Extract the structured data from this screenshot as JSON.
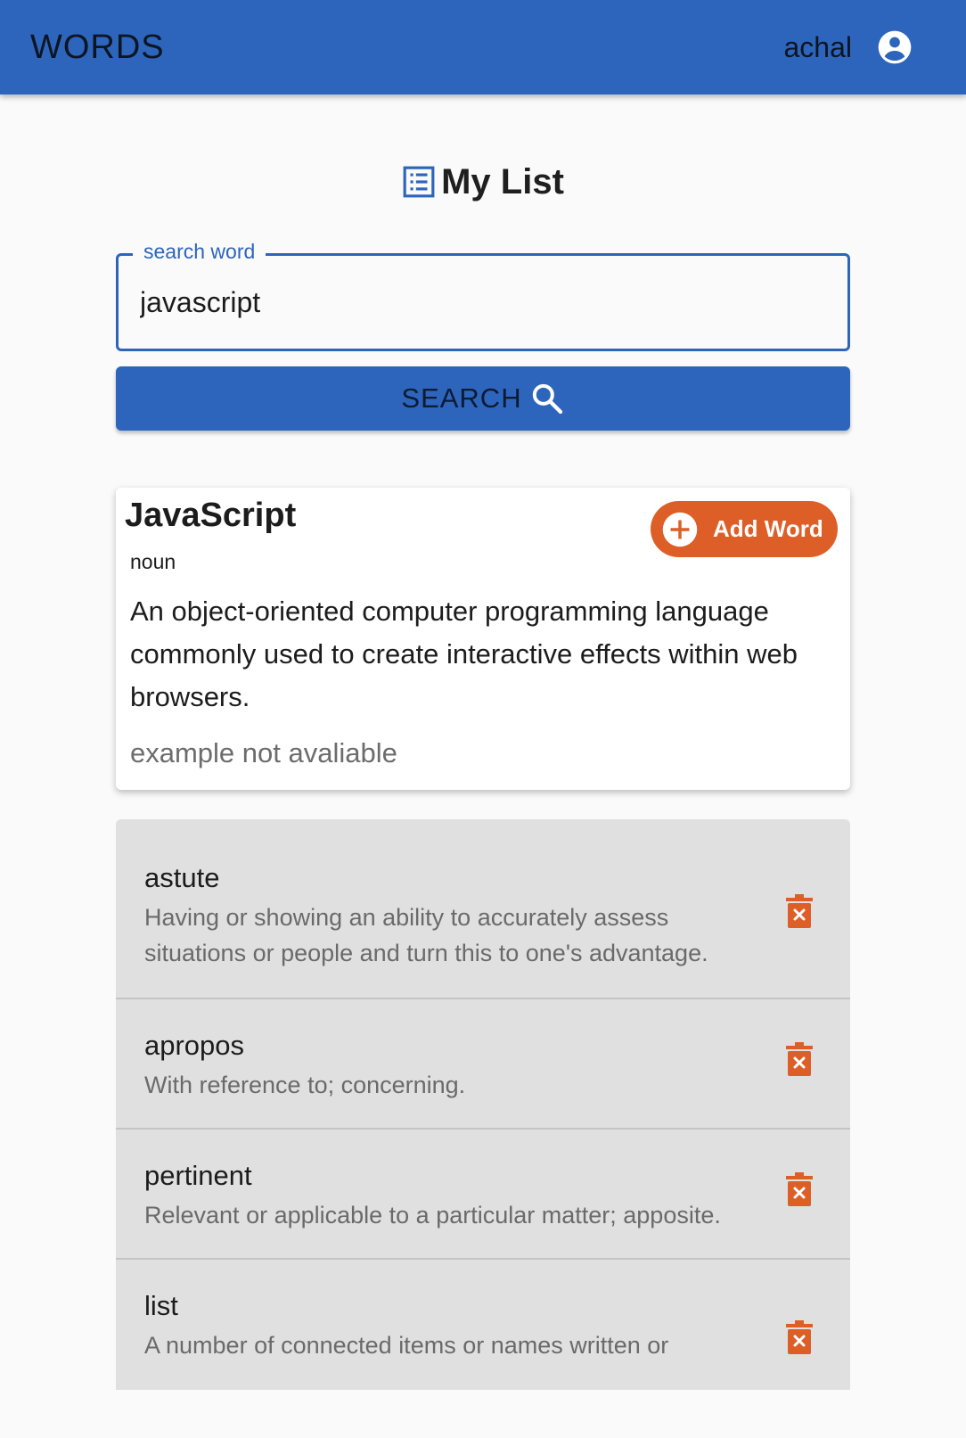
{
  "appbar": {
    "brand": "WORDS",
    "username": "achal",
    "avatar_icon": "account-circle-icon"
  },
  "heading": {
    "icon": "list-icon",
    "title": "My List"
  },
  "search": {
    "label": "search word",
    "value": "javascript",
    "button_label": "SEARCH",
    "button_icon": "search-icon"
  },
  "result": {
    "word": "JavaScript",
    "add_label": "Add Word",
    "add_icon": "add-circle-icon",
    "part_of_speech": "noun",
    "definition": "An object-oriented computer programming language commonly used to create interactive effects within web browsers.",
    "example": "example not avaliable"
  },
  "saved_words": [
    {
      "word": "astute",
      "definition": "Having or showing an ability to accurately assess situations or people and turn this to one's advantage."
    },
    {
      "word": "apropos",
      "definition": "With reference to; concerning."
    },
    {
      "word": "pertinent",
      "definition": "Relevant or applicable to a particular matter; apposite."
    },
    {
      "word": "list",
      "definition": "A number of connected items or names written or"
    }
  ],
  "colors": {
    "primary": "#2d65bd",
    "accent": "#dd5f27",
    "background": "#fafafa",
    "list_background": "#e0e0e0"
  }
}
